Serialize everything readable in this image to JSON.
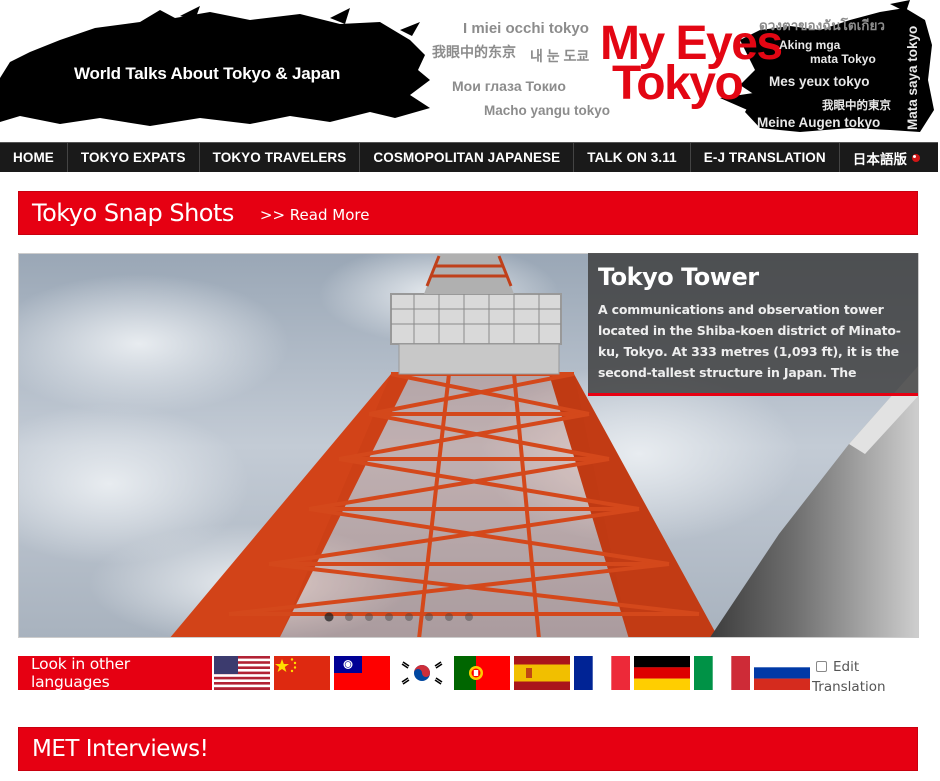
{
  "header": {
    "tagline": "World Talks About Tokyo & Japan",
    "logo_line1": "My Eyes",
    "logo_line2": "Tokyo",
    "languages": {
      "italian": "I miei occhi tokyo",
      "chinese": "我眼中的东京",
      "korean": "내 눈 도쿄",
      "russian": "Мои глаза Токио",
      "swahili": "Macho yangu tokyo",
      "thai": "ดวงตาของฉันโตเกียว",
      "filipino_a": "Aking mga",
      "filipino_b": "mata Tokyo",
      "french": "Mes yeux tokyo",
      "chinese_trad": "我眼中的東京",
      "german": "Meine Augen tokyo",
      "malay": "Mata saya tokyo"
    }
  },
  "nav": {
    "items": [
      {
        "label": "HOME"
      },
      {
        "label": "TOKYO EXPATS"
      },
      {
        "label": "TOKYO TRAVELERS"
      },
      {
        "label": "COSMOPOLITAN JAPANESE"
      },
      {
        "label": "TALK ON 3.11"
      },
      {
        "label": "E-J TRANSLATION"
      },
      {
        "label": "日本語版"
      }
    ]
  },
  "snapshots": {
    "title": "Tokyo Snap Shots",
    "read_more": ">> Read More"
  },
  "slide": {
    "title": "Tokyo Tower",
    "description": "A communications and observation tower located in the Shiba-koen district of Minato-ku, Tokyo. At 333 metres (1,093 ft), it is the second-tallest structure in Japan. The"
  },
  "languages_bar": {
    "label": "Look in other languages",
    "flags": [
      "flag-usa-icon",
      "flag-china-icon",
      "flag-taiwan-icon",
      "flag-korea-icon",
      "flag-portugal-icon",
      "flag-spain-icon",
      "flag-france-icon",
      "flag-germany-icon",
      "flag-italy-icon",
      "flag-russia-icon"
    ],
    "edit_label": "Edit",
    "translation_label": "Translation"
  },
  "met": {
    "title": "MET Interviews!"
  },
  "colors": {
    "accent_red": "#e60012",
    "nav_bg": "#1a1a1a"
  }
}
